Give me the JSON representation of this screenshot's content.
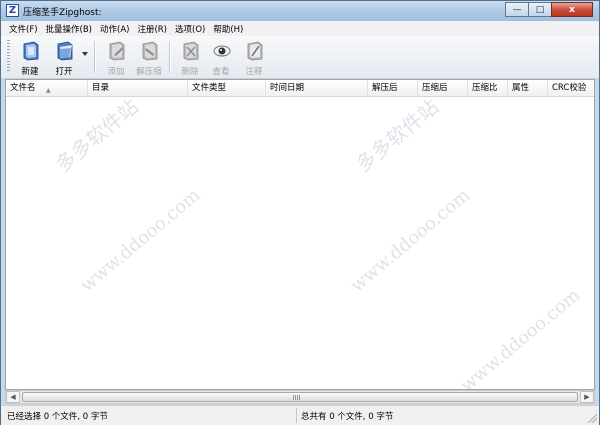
{
  "window": {
    "title": "压缩圣手Zipghost:",
    "icon": "Z",
    "minimize": "—",
    "maximize": "□",
    "close": "x"
  },
  "menu": [
    "文件(F)",
    "批量操作(B)",
    "动作(A)",
    "注册(R)",
    "选项(O)",
    "帮助(H)"
  ],
  "toolbar": {
    "new": "新建",
    "open": "打开",
    "add": "添加",
    "extract": "解压缩",
    "delete": "删除",
    "view": "查看",
    "comment": "注释"
  },
  "columns": {
    "name": "文件名",
    "dir": "目录",
    "type": "文件类型",
    "datetime": "时间日期",
    "unpacked": "解压后",
    "packed": "压缩后",
    "ratio": "压缩比",
    "attr": "属性",
    "crc": "CRC校验"
  },
  "watermarks": [
    "www.ddooo.com",
    "多多软件站",
    "www.ddooo.com",
    "多多软件站",
    "www.ddooo.com"
  ],
  "status": {
    "selected": "已经选择 0 个文件, 0 字节",
    "total": "总共有 0 个文件, 0 字节"
  },
  "colors": {
    "titlebar": "#aecae6",
    "accent": "#1f44a8",
    "close": "#c9503c"
  }
}
